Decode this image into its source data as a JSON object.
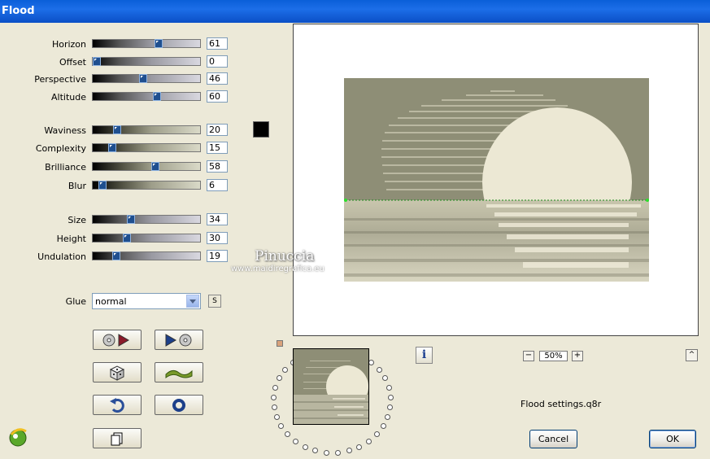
{
  "window": {
    "title": "Flood"
  },
  "sliders": [
    {
      "label": "Horizon",
      "value": "61",
      "level": 61
    },
    {
      "label": "Offset",
      "value": "0",
      "level": 0
    },
    {
      "label": "Perspective",
      "value": "46",
      "level": 46
    },
    {
      "label": "Altitude",
      "value": "60",
      "level": 60
    },
    {
      "label": "Waviness",
      "value": "20",
      "level": 20
    },
    {
      "label": "Complexity",
      "value": "15",
      "level": 15
    },
    {
      "label": "Brilliance",
      "value": "58",
      "level": 58
    },
    {
      "label": "Blur",
      "value": "6",
      "level": 6
    },
    {
      "label": "Size",
      "value": "34",
      "level": 34
    },
    {
      "label": "Height",
      "value": "30",
      "level": 30
    },
    {
      "label": "Undulation",
      "value": "19",
      "level": 19
    }
  ],
  "color_swatch": "#000000",
  "glue": {
    "label": "Glue",
    "value": "normal",
    "s_label": "S"
  },
  "preview": {
    "watermark_name": "Pinuccia",
    "watermark_url": "www.maidiregrafica.eu",
    "background_color": "#8e8e76",
    "sun_color": "#ece8d4"
  },
  "zoom": {
    "minus": "−",
    "value": "50%",
    "plus": "+"
  },
  "info_label": "i",
  "collapse_label": "^",
  "settings_file": "Flood settings.q8r",
  "buttons": {
    "cancel": "Cancel",
    "ok": "OK"
  }
}
